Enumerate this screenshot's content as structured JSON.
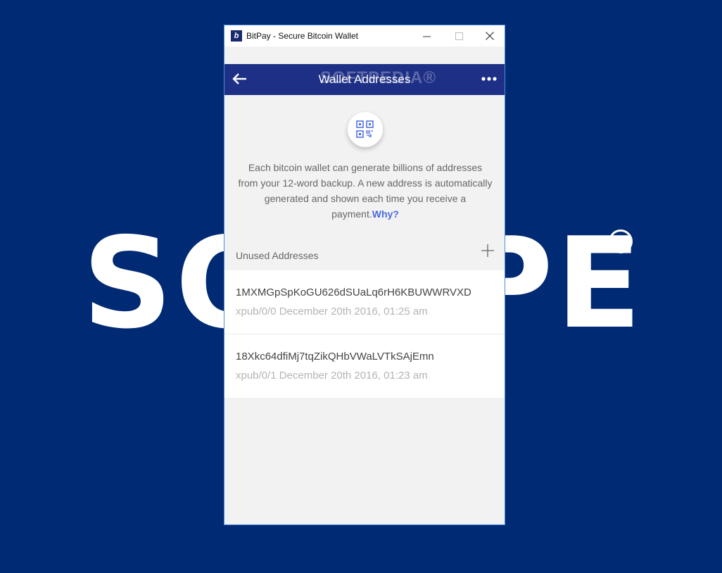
{
  "background_watermark": {
    "text": "SOFTPEDIA",
    "registered": "®"
  },
  "window": {
    "title": "BitPay - Secure Bitcoin Wallet",
    "app_icon_letter": "b",
    "controls": {
      "minimize": "—",
      "maximize": "☐",
      "close": "✕"
    }
  },
  "nav": {
    "title": "Wallet Addresses",
    "watermark": "SOFTPEDIA®"
  },
  "hero": {
    "description": "Each bitcoin wallet can generate billions of addresses from your 12-word backup. A new address is automatically generated and shown each time you receive a payment.",
    "why_link": "Why?"
  },
  "unused": {
    "label": "Unused Addresses",
    "addresses": [
      {
        "address": "1MXMGpSpKoGU626dSUaLq6rH6KBUWWRVXD",
        "meta": "xpub/0/0 December 20th 2016, 01:25 am"
      },
      {
        "address": "18Xkc64dfiMj7tqZikQHbVWaLVTkSAjEmn",
        "meta": "xpub/0/1 December 20th 2016, 01:23 am"
      }
    ]
  },
  "colors": {
    "desktop": "#012a74",
    "nav": "#1e2f86",
    "link": "#4a69e2"
  }
}
